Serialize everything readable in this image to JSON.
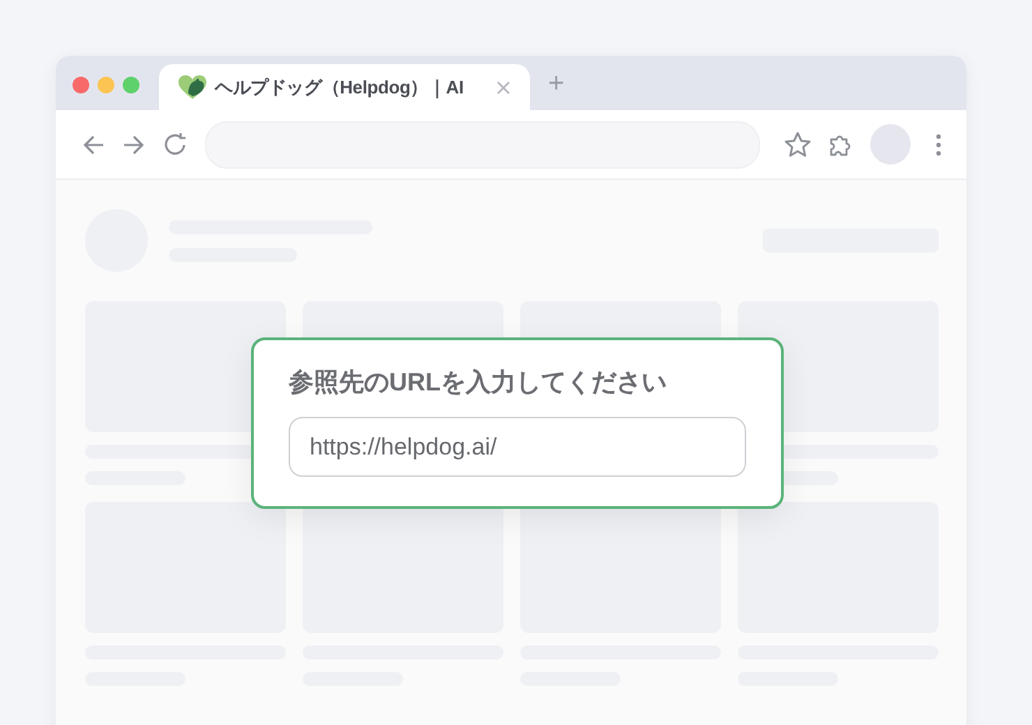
{
  "browser": {
    "tab": {
      "title": "ヘルプドッグ（Helpdog）｜AI"
    },
    "new_tab": "+"
  },
  "dialog": {
    "prompt": "参照先のURLを入力してください",
    "url_field": {
      "value": "https://helpdog.ai/"
    }
  }
}
